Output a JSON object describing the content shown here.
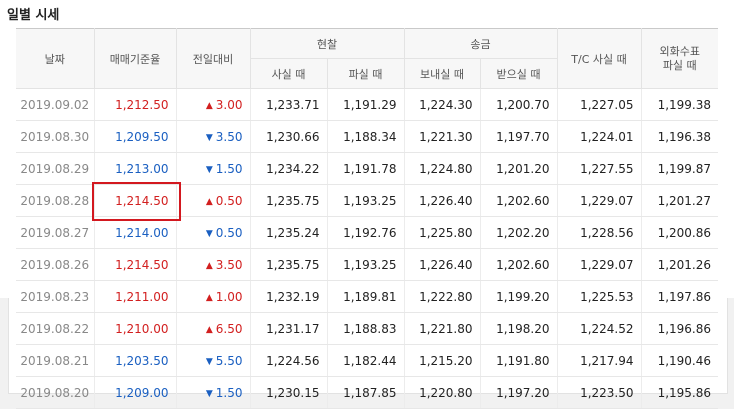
{
  "title": "일별 시세",
  "headers": {
    "date": "날짜",
    "base_rate": "매매기준율",
    "change": "전일대비",
    "cash": "현찰",
    "cash_buy": "사실 때",
    "cash_sell": "파실 때",
    "transfer": "송금",
    "transfer_send": "보내실 때",
    "transfer_receive": "받으실 때",
    "tc_buy": "T/C 사실 때",
    "foreign_check_line1": "외화수표",
    "foreign_check_line2": "파실 때"
  },
  "rows": [
    {
      "date": "2019.09.02",
      "base": "1,212.50",
      "dir": "up",
      "change": "3.00",
      "cash_buy": "1,233.71",
      "cash_sell": "1,191.29",
      "send": "1,224.30",
      "receive": "1,200.70",
      "tc": "1,227.05",
      "check": "1,199.38"
    },
    {
      "date": "2019.08.30",
      "base": "1,209.50",
      "dir": "down",
      "change": "3.50",
      "cash_buy": "1,230.66",
      "cash_sell": "1,188.34",
      "send": "1,221.30",
      "receive": "1,197.70",
      "tc": "1,224.01",
      "check": "1,196.38"
    },
    {
      "date": "2019.08.29",
      "base": "1,213.00",
      "dir": "down",
      "change": "1.50",
      "cash_buy": "1,234.22",
      "cash_sell": "1,191.78",
      "send": "1,224.80",
      "receive": "1,201.20",
      "tc": "1,227.55",
      "check": "1,199.87"
    },
    {
      "date": "2019.08.28",
      "base": "1,214.50",
      "dir": "up",
      "change": "0.50",
      "cash_buy": "1,235.75",
      "cash_sell": "1,193.25",
      "send": "1,226.40",
      "receive": "1,202.60",
      "tc": "1,229.07",
      "check": "1,201.27",
      "highlighted": true
    },
    {
      "date": "2019.08.27",
      "base": "1,214.00",
      "dir": "down",
      "change": "0.50",
      "cash_buy": "1,235.24",
      "cash_sell": "1,192.76",
      "send": "1,225.80",
      "receive": "1,202.20",
      "tc": "1,228.56",
      "check": "1,200.86"
    },
    {
      "date": "2019.08.26",
      "base": "1,214.50",
      "dir": "up",
      "change": "3.50",
      "cash_buy": "1,235.75",
      "cash_sell": "1,193.25",
      "send": "1,226.40",
      "receive": "1,202.60",
      "tc": "1,229.07",
      "check": "1,201.26"
    },
    {
      "date": "2019.08.23",
      "base": "1,211.00",
      "dir": "up",
      "change": "1.00",
      "cash_buy": "1,232.19",
      "cash_sell": "1,189.81",
      "send": "1,222.80",
      "receive": "1,199.20",
      "tc": "1,225.53",
      "check": "1,197.86"
    },
    {
      "date": "2019.08.22",
      "base": "1,210.00",
      "dir": "up",
      "change": "6.50",
      "cash_buy": "1,231.17",
      "cash_sell": "1,188.83",
      "send": "1,221.80",
      "receive": "1,198.20",
      "tc": "1,224.52",
      "check": "1,196.86"
    },
    {
      "date": "2019.08.21",
      "base": "1,203.50",
      "dir": "down",
      "change": "5.50",
      "cash_buy": "1,224.56",
      "cash_sell": "1,182.44",
      "send": "1,215.20",
      "receive": "1,191.80",
      "tc": "1,217.94",
      "check": "1,190.46"
    },
    {
      "date": "2019.08.20",
      "base": "1,209.00",
      "dir": "down",
      "change": "1.50",
      "cash_buy": "1,230.15",
      "cash_sell": "1,187.85",
      "send": "1,220.80",
      "receive": "1,197.20",
      "tc": "1,223.50",
      "check": "1,195.86"
    }
  ],
  "colors": {
    "up": "#d21f1f",
    "down": "#1a5fc1",
    "highlight_border": "#d3181f"
  },
  "icons": {
    "up": "triangle-up-icon",
    "down": "triangle-down-icon"
  }
}
